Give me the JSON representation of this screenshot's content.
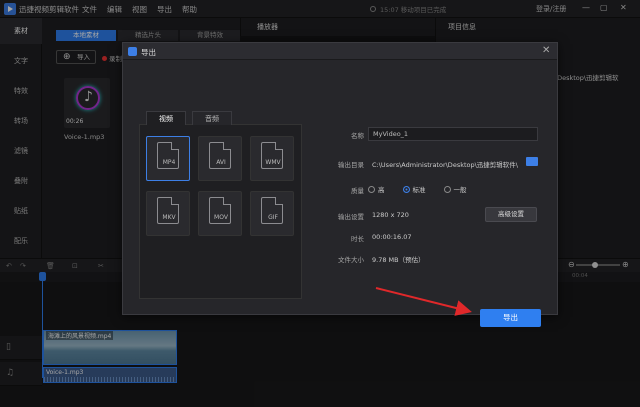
{
  "app": {
    "title": "迅捷视频剪辑软件",
    "menu": [
      "文件",
      "编辑",
      "视图",
      "导出",
      "帮助"
    ],
    "status": "15:07 移动项目已完成",
    "login": "登录/注册",
    "win_min": "—",
    "win_max": "▢",
    "win_close": "✕"
  },
  "nav": [
    "素材",
    "文字",
    "特效",
    "转场",
    "滤镜",
    "叠附",
    "贴纸",
    "配乐"
  ],
  "media": {
    "tabs": [
      "本地素材",
      "精选片头",
      "背景特效"
    ],
    "import_label": "导入",
    "record_label": "录制",
    "items": [
      {
        "duration": "00:26",
        "name": "Voice-1.mp3"
      }
    ]
  },
  "player": {
    "title": "播放器"
  },
  "info": {
    "title": "项目信息",
    "path": ".Desktop\\迅捷剪辑软"
  },
  "timeline": {
    "ruler_label": "00:04",
    "video_clip": "海滩上的风景视频.mp4",
    "audio_clip": "Voice-1.mp3"
  },
  "dialog": {
    "title": "导出",
    "close": "✕",
    "tabs": [
      "视频",
      "音频"
    ],
    "formats": [
      "MP4",
      "AVI",
      "WMV",
      "MKV",
      "MOV",
      "GIF"
    ],
    "labels": {
      "name": "名称",
      "dir": "输出目录",
      "quality": "质量",
      "settings": "输出设置",
      "duration": "时长",
      "size": "文件大小"
    },
    "name_value": "MyVideo_1",
    "dir_value": "C:\\Users\\Administrator\\Desktop\\迅捷剪辑软件\\",
    "quality_options": [
      "高",
      "标准",
      "一般"
    ],
    "quality_selected": "标准",
    "settings_value": "1280 x 720",
    "duration_value": "00:00:16.07",
    "size_value": "9.78 MB（预估）",
    "advanced_button": "高级设置",
    "export_button": "导出"
  },
  "colors": {
    "accent": "#2f7ff0",
    "annotation_arrow": "#e0282a",
    "background": "#1b1b1d"
  }
}
